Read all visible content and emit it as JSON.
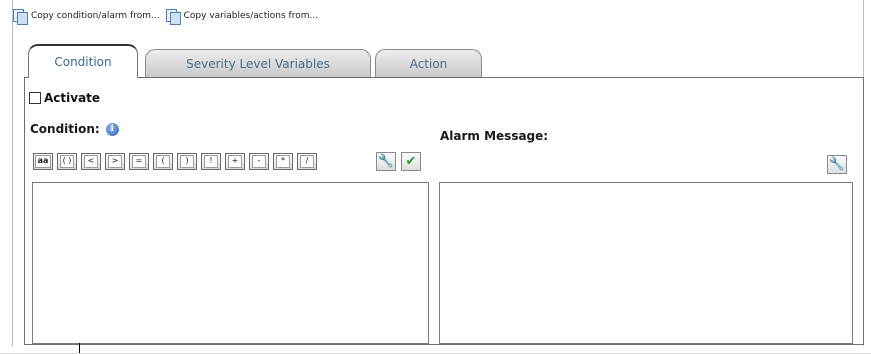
{
  "toolbar": {
    "copy_condition": "Copy condition/alarm from...",
    "copy_variables": "Copy variables/actions from..."
  },
  "tabs": [
    {
      "label": "Condition",
      "active": true
    },
    {
      "label": "Severity Level Variables",
      "active": false
    },
    {
      "label": "Action",
      "active": false
    }
  ],
  "activate": {
    "label": "Activate",
    "checked": false
  },
  "condition": {
    "label": "Condition:",
    "info_icon": "info-icon",
    "operators": [
      "aa",
      "( )",
      "<",
      ">",
      "=",
      "(",
      ")",
      "!",
      "+",
      "-",
      "*",
      "/"
    ],
    "value": ""
  },
  "alarm": {
    "label": "Alarm Message:",
    "value": ""
  },
  "colors": {
    "tab_text": "#4a6d8a",
    "info": "#2f64b0",
    "wrench": "#d98a2a",
    "check": "#2f9a2f"
  }
}
